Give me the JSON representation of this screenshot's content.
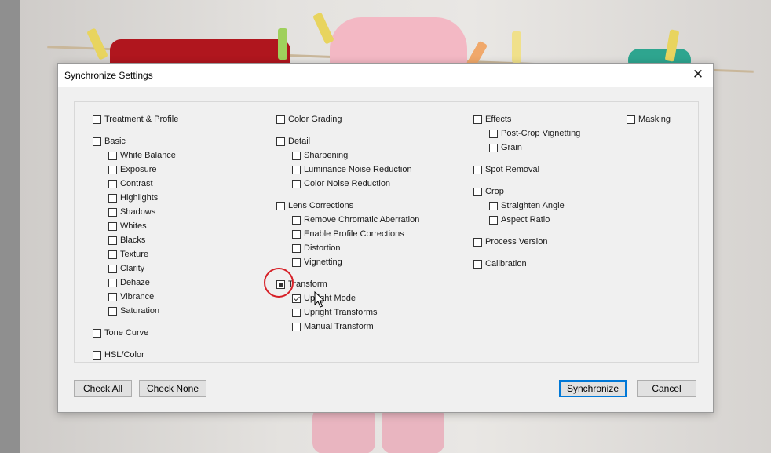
{
  "dialog": {
    "title": "Synchronize Settings",
    "close_glyph": "✕"
  },
  "columns": [
    [
      {
        "id": "treatment-profile",
        "label": "Treatment & Profile",
        "checked": false,
        "level": 0
      },
      {
        "id": "basic",
        "label": "Basic",
        "checked": false,
        "level": 0,
        "gap": true
      },
      {
        "id": "white-balance",
        "label": "White Balance",
        "checked": false,
        "level": 1
      },
      {
        "id": "exposure",
        "label": "Exposure",
        "checked": false,
        "level": 1
      },
      {
        "id": "contrast",
        "label": "Contrast",
        "checked": false,
        "level": 1
      },
      {
        "id": "highlights",
        "label": "Highlights",
        "checked": false,
        "level": 1
      },
      {
        "id": "shadows",
        "label": "Shadows",
        "checked": false,
        "level": 1
      },
      {
        "id": "whites",
        "label": "Whites",
        "checked": false,
        "level": 1
      },
      {
        "id": "blacks",
        "label": "Blacks",
        "checked": false,
        "level": 1
      },
      {
        "id": "texture",
        "label": "Texture",
        "checked": false,
        "level": 1
      },
      {
        "id": "clarity",
        "label": "Clarity",
        "checked": false,
        "level": 1
      },
      {
        "id": "dehaze",
        "label": "Dehaze",
        "checked": false,
        "level": 1
      },
      {
        "id": "vibrance",
        "label": "Vibrance",
        "checked": false,
        "level": 1
      },
      {
        "id": "saturation",
        "label": "Saturation",
        "checked": false,
        "level": 1
      },
      {
        "id": "tone-curve",
        "label": "Tone Curve",
        "checked": false,
        "level": 0,
        "gap": true
      },
      {
        "id": "hsl-color",
        "label": "HSL/Color",
        "checked": false,
        "level": 0,
        "gap": true
      }
    ],
    [
      {
        "id": "color-grading",
        "label": "Color Grading",
        "checked": false,
        "level": 0
      },
      {
        "id": "detail",
        "label": "Detail",
        "checked": false,
        "level": 0,
        "gap": true
      },
      {
        "id": "sharpening",
        "label": "Sharpening",
        "checked": false,
        "level": 1
      },
      {
        "id": "luminance-noise-reduction",
        "label": "Luminance Noise Reduction",
        "checked": false,
        "level": 1
      },
      {
        "id": "color-noise-reduction",
        "label": "Color Noise Reduction",
        "checked": false,
        "level": 1
      },
      {
        "id": "lens-corrections",
        "label": "Lens Corrections",
        "checked": false,
        "level": 0,
        "gap": true
      },
      {
        "id": "remove-chromatic-aberration",
        "label": "Remove Chromatic Aberration",
        "checked": false,
        "level": 1
      },
      {
        "id": "enable-profile-corrections",
        "label": "Enable Profile Corrections",
        "checked": false,
        "level": 1
      },
      {
        "id": "distortion",
        "label": "Distortion",
        "checked": false,
        "level": 1
      },
      {
        "id": "vignetting",
        "label": "Vignetting",
        "checked": false,
        "level": 1
      },
      {
        "id": "transform",
        "label": "Transform",
        "checked": "mixed",
        "level": 0,
        "gap": true
      },
      {
        "id": "upright-mode",
        "label": "Upright Mode",
        "checked": true,
        "level": 1
      },
      {
        "id": "upright-transforms",
        "label": "Upright Transforms",
        "checked": false,
        "level": 1
      },
      {
        "id": "manual-transform",
        "label": "Manual Transform",
        "checked": false,
        "level": 1
      }
    ],
    [
      {
        "id": "effects",
        "label": "Effects",
        "checked": false,
        "level": 0
      },
      {
        "id": "post-crop-vignetting",
        "label": "Post-Crop Vignetting",
        "checked": false,
        "level": 1
      },
      {
        "id": "grain",
        "label": "Grain",
        "checked": false,
        "level": 1
      },
      {
        "id": "spot-removal",
        "label": "Spot Removal",
        "checked": false,
        "level": 0,
        "gap": true
      },
      {
        "id": "crop",
        "label": "Crop",
        "checked": false,
        "level": 0,
        "gap": true
      },
      {
        "id": "straighten-angle",
        "label": "Straighten Angle",
        "checked": false,
        "level": 1
      },
      {
        "id": "aspect-ratio",
        "label": "Aspect Ratio",
        "checked": false,
        "level": 1
      },
      {
        "id": "process-version",
        "label": "Process Version",
        "checked": false,
        "level": 0,
        "gap": true
      },
      {
        "id": "calibration",
        "label": "Calibration",
        "checked": false,
        "level": 0,
        "gap": true
      }
    ],
    [
      {
        "id": "masking",
        "label": "Masking",
        "checked": false,
        "level": 0
      }
    ]
  ],
  "buttons": {
    "check_all": "Check All",
    "check_none": "Check None",
    "synchronize": "Synchronize",
    "cancel": "Cancel"
  },
  "colors": {
    "highlight_ring": "#d61f26",
    "default_button_border": "#0078d7"
  }
}
